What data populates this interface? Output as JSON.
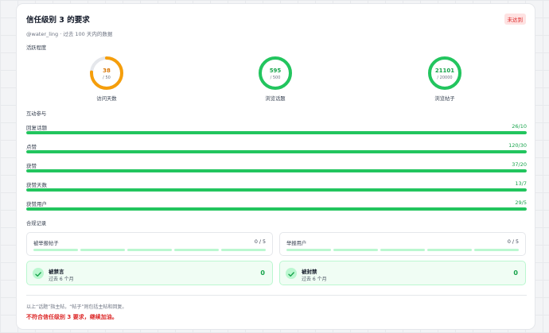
{
  "header": {
    "title": "信任级别 3 的要求",
    "status_badge": "未达到",
    "subtitle": "@water_ling · 过去 100 天内的数据"
  },
  "activity": {
    "section_label": "活跃程度",
    "rings": [
      {
        "value": "38",
        "goal": "/ 50",
        "label": "访问天数",
        "progress": 0.76,
        "color": "#f59e0b"
      },
      {
        "value": "595",
        "goal": "/ 500",
        "label": "浏览话题",
        "progress": 1.0,
        "color": "#22c55e"
      },
      {
        "value": "21101",
        "goal": "/ 20000",
        "label": "浏览帖子",
        "progress": 1.0,
        "color": "#22c55e"
      }
    ]
  },
  "interaction": {
    "section_label": "互动参与",
    "bars": [
      {
        "label": "回复话题",
        "value": "26/10",
        "progress": 1.0
      },
      {
        "label": "点赞",
        "value": "120/30",
        "progress": 1.0
      },
      {
        "label": "获赞",
        "value": "37/20",
        "progress": 1.0
      },
      {
        "label": "获赞天数",
        "value": "13/7",
        "progress": 1.0
      },
      {
        "label": "获赞用户",
        "value": "29/5",
        "progress": 1.0
      }
    ]
  },
  "compliance": {
    "section_label": "合规记录",
    "reported_posts": {
      "label": "被举报帖子",
      "value": "0 / 5"
    },
    "reported_users": {
      "label": "举报用户",
      "value": "0 / 5"
    },
    "silenced": {
      "title": "被禁言",
      "subtitle": "过去 6 个月",
      "value": "0"
    },
    "suspended": {
      "title": "被封禁",
      "subtitle": "过去 6 个月",
      "value": "0"
    }
  },
  "footer": {
    "note": "以上“话题”指主帖，“帖子”则包括主帖和回复。",
    "status": "不符合信任级别 3 要求，继续加油。"
  },
  "colors": {
    "accent": "#22c55e",
    "warning": "#f59e0b",
    "danger": "#dc2626"
  }
}
